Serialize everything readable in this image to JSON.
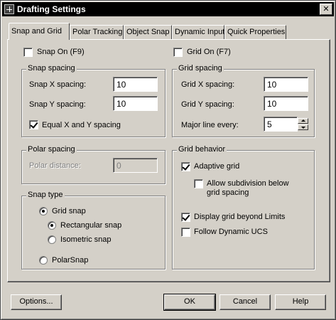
{
  "window": {
    "title": "Drafting Settings",
    "close_glyph": "✕"
  },
  "tabs": [
    {
      "label": "Snap and Grid",
      "active": true
    },
    {
      "label": "Polar Tracking",
      "active": false
    },
    {
      "label": "Object Snap",
      "active": false
    },
    {
      "label": "Dynamic Input",
      "active": false
    },
    {
      "label": "Quick Properties",
      "active": false
    }
  ],
  "snap_on": {
    "label": "Snap On (F9)",
    "checked": false
  },
  "grid_on": {
    "label": "Grid On (F7)",
    "checked": false
  },
  "snap_spacing": {
    "title": "Snap spacing",
    "x_label": "Snap X spacing:",
    "x_value": "10",
    "y_label": "Snap Y spacing:",
    "y_value": "10",
    "equal_label": "Equal X and Y spacing",
    "equal_checked": true
  },
  "polar_spacing": {
    "title": "Polar spacing",
    "distance_label": "Polar distance:",
    "distance_value": "0"
  },
  "snap_type": {
    "title": "Snap type",
    "grid_snap": "Grid snap",
    "rectangular": "Rectangular snap",
    "isometric": "Isometric snap",
    "polar": "PolarSnap"
  },
  "grid_spacing": {
    "title": "Grid spacing",
    "x_label": "Grid X spacing:",
    "x_value": "10",
    "y_label": "Grid Y spacing:",
    "y_value": "10",
    "major_label": "Major line every:",
    "major_value": "5"
  },
  "grid_behavior": {
    "title": "Grid behavior",
    "adaptive": "Adaptive grid",
    "subdivision_line1": "Allow subdivision below",
    "subdivision_line2": "grid spacing",
    "beyond_limits": "Display grid beyond Limits",
    "dynamic_ucs": "Follow Dynamic UCS"
  },
  "buttons": {
    "options": "Options...",
    "ok": "OK",
    "cancel": "Cancel",
    "help": "Help"
  }
}
